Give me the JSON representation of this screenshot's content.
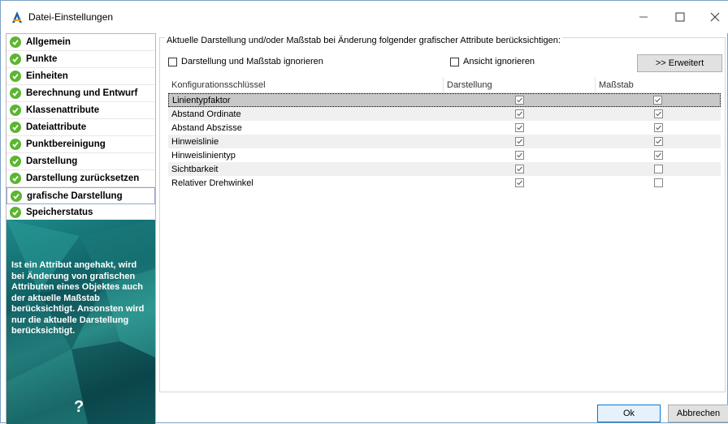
{
  "window": {
    "title": "Datei-Einstellungen",
    "minimize_glyph": "—",
    "maximize_glyph": "☐",
    "close_glyph": "✕",
    "app_icon": "a-logo-icon"
  },
  "sidebar": {
    "items": [
      {
        "label": "Allgemein",
        "icon": "check-circle-icon"
      },
      {
        "label": "Punkte",
        "icon": "check-circle-icon"
      },
      {
        "label": "Einheiten",
        "icon": "check-circle-icon"
      },
      {
        "label": "Berechnung und Entwurf",
        "icon": "check-circle-icon"
      },
      {
        "label": "Klassenattribute",
        "icon": "check-circle-icon"
      },
      {
        "label": "Dateiattribute",
        "icon": "check-circle-icon"
      },
      {
        "label": "Punktbereinigung",
        "icon": "check-circle-icon"
      },
      {
        "label": "Darstellung",
        "icon": "check-circle-icon"
      },
      {
        "label": "Darstellung zurücksetzen",
        "icon": "check-circle-icon"
      },
      {
        "label": "grafische Darstellung",
        "icon": "check-circle-icon",
        "selected": true
      },
      {
        "label": "Speicherstatus",
        "icon": "check-circle-icon"
      }
    ],
    "info_text": "Ist ein Attribut angehakt, wird bei Änderung von grafischen Attributen eines Objektes auch der aktuelle Maßstab berücksichtigt. Ansonsten wird nur die aktuelle Darstellung berücksichtigt.",
    "help_glyph": "?"
  },
  "main": {
    "group_title": "Aktuelle Darstellung und/oder Maßstab bei Änderung folgender grafischer Attribute berücksichtigen:",
    "ignore_darstellung_massstab_label": "Darstellung und Maßstab ignorieren",
    "ignore_ansicht_label": "Ansicht ignorieren",
    "erweitert_label": ">> Erweitert",
    "columns": [
      "Konfigurationsschlüssel",
      "Darstellung",
      "Maßstab"
    ],
    "rows": [
      {
        "key": "Linientypfaktor",
        "darstellung": true,
        "massstab": true,
        "selected": true
      },
      {
        "key": "Abstand Ordinate",
        "darstellung": true,
        "massstab": true
      },
      {
        "key": "Abstand Abszisse",
        "darstellung": true,
        "massstab": true
      },
      {
        "key": "Hinweislinie",
        "darstellung": true,
        "massstab": true
      },
      {
        "key": "Hinweislinientyp",
        "darstellung": true,
        "massstab": true
      },
      {
        "key": "Sichtbarkeit",
        "darstellung": true,
        "massstab": false
      },
      {
        "key": "Relativer Drehwinkel",
        "darstellung": true,
        "massstab": false
      }
    ]
  },
  "footer": {
    "ok_label": "Ok",
    "cancel_label": "Abbrechen"
  },
  "colors": {
    "check_green": "#5cb531",
    "info_panel_teal": "#0f5f63",
    "ok_border": "#0078d7"
  }
}
